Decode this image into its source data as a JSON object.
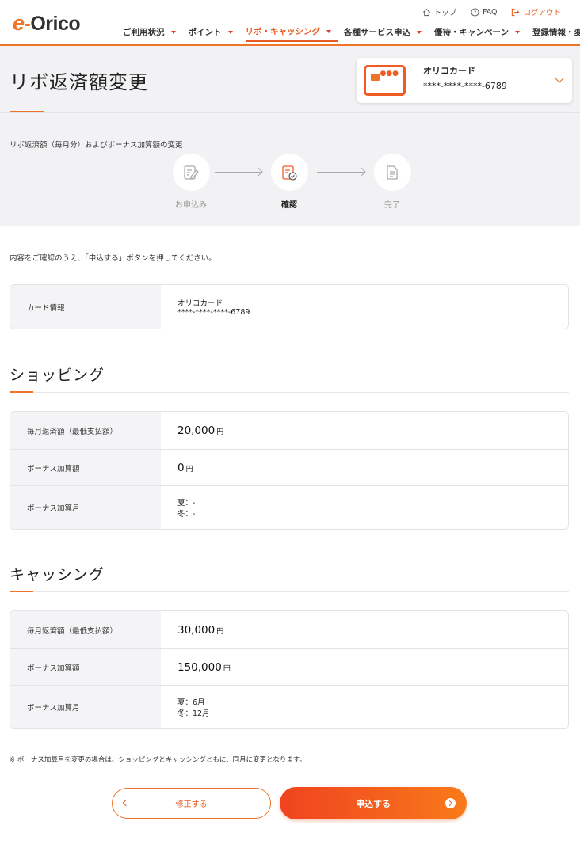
{
  "header": {
    "logo_e": "e",
    "logo_dash": "-",
    "logo_text": "Orico",
    "util": [
      {
        "icon": "home-icon",
        "label": "トップ"
      },
      {
        "icon": "help-icon",
        "label": "FAQ"
      },
      {
        "icon": "logout-icon",
        "label": "ログアウト"
      }
    ],
    "nav": [
      {
        "label": "ご利用状況",
        "active": false
      },
      {
        "label": "ポイント",
        "active": false
      },
      {
        "label": "リボ・キャッシング",
        "active": true
      },
      {
        "label": "各種サービス申込",
        "active": false
      },
      {
        "label": "優待・キャンペーン",
        "active": false
      },
      {
        "label": "登録情報・変更",
        "active": false
      }
    ]
  },
  "page": {
    "title": "リボ返済額変更",
    "step_description": "リボ返済額（毎月分）およびボーナス加算額の変更",
    "steps": [
      {
        "label": "お申込み",
        "icon": "form-edit-icon"
      },
      {
        "label": "確認",
        "icon": "document-check-icon"
      },
      {
        "label": "完了",
        "icon": "document-icon"
      }
    ],
    "intro": "内容をご確認のうえ、「申込する」ボタンを押してください。"
  },
  "card_selector": {
    "name": "オリコカード",
    "number": "****-****-****-6789"
  },
  "card_info": {
    "label": "カード情報",
    "name": "オリコカード",
    "number": "****-****-****-6789"
  },
  "shopping": {
    "title": "ショッピング",
    "monthly_label": "毎月返済額（最低支払額）",
    "monthly_amount": "20,000",
    "bonus_label": "ボーナス加算額",
    "bonus_amount": "0",
    "bonus_month_label": "ボーナス加算月",
    "summer": "夏：-",
    "winter": "冬：-"
  },
  "cashing": {
    "title": "キャッシング",
    "monthly_label": "毎月返済額（最低支払額）",
    "monthly_amount": "30,000",
    "bonus_label": "ボーナス加算額",
    "bonus_amount": "150,000",
    "bonus_month_label": "ボーナス加算月",
    "summer": "夏：6月",
    "winter": "冬：12月"
  },
  "yen_unit": "円",
  "note": "※ ボーナス加算月を変更の場合は、ショッピングとキャッシングともに、同月に変更となります。",
  "buttons": {
    "fix": "修正する",
    "apply": "申込する"
  },
  "colors": {
    "accent": "#f0732a",
    "accent_dark": "#e85d1f"
  }
}
